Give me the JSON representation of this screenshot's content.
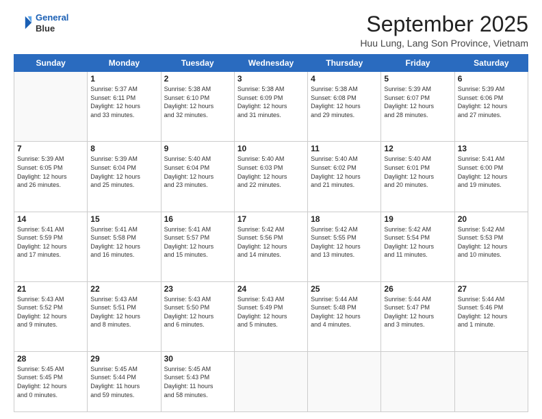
{
  "header": {
    "logo_line1": "General",
    "logo_line2": "Blue",
    "title": "September 2025",
    "subtitle": "Huu Lung, Lang Son Province, Vietnam"
  },
  "weekdays": [
    "Sunday",
    "Monday",
    "Tuesday",
    "Wednesday",
    "Thursday",
    "Friday",
    "Saturday"
  ],
  "weeks": [
    [
      {
        "day": "",
        "info": ""
      },
      {
        "day": "1",
        "info": "Sunrise: 5:37 AM\nSunset: 6:11 PM\nDaylight: 12 hours\nand 33 minutes."
      },
      {
        "day": "2",
        "info": "Sunrise: 5:38 AM\nSunset: 6:10 PM\nDaylight: 12 hours\nand 32 minutes."
      },
      {
        "day": "3",
        "info": "Sunrise: 5:38 AM\nSunset: 6:09 PM\nDaylight: 12 hours\nand 31 minutes."
      },
      {
        "day": "4",
        "info": "Sunrise: 5:38 AM\nSunset: 6:08 PM\nDaylight: 12 hours\nand 29 minutes."
      },
      {
        "day": "5",
        "info": "Sunrise: 5:39 AM\nSunset: 6:07 PM\nDaylight: 12 hours\nand 28 minutes."
      },
      {
        "day": "6",
        "info": "Sunrise: 5:39 AM\nSunset: 6:06 PM\nDaylight: 12 hours\nand 27 minutes."
      }
    ],
    [
      {
        "day": "7",
        "info": "Sunrise: 5:39 AM\nSunset: 6:05 PM\nDaylight: 12 hours\nand 26 minutes."
      },
      {
        "day": "8",
        "info": "Sunrise: 5:39 AM\nSunset: 6:04 PM\nDaylight: 12 hours\nand 25 minutes."
      },
      {
        "day": "9",
        "info": "Sunrise: 5:40 AM\nSunset: 6:04 PM\nDaylight: 12 hours\nand 23 minutes."
      },
      {
        "day": "10",
        "info": "Sunrise: 5:40 AM\nSunset: 6:03 PM\nDaylight: 12 hours\nand 22 minutes."
      },
      {
        "day": "11",
        "info": "Sunrise: 5:40 AM\nSunset: 6:02 PM\nDaylight: 12 hours\nand 21 minutes."
      },
      {
        "day": "12",
        "info": "Sunrise: 5:40 AM\nSunset: 6:01 PM\nDaylight: 12 hours\nand 20 minutes."
      },
      {
        "day": "13",
        "info": "Sunrise: 5:41 AM\nSunset: 6:00 PM\nDaylight: 12 hours\nand 19 minutes."
      }
    ],
    [
      {
        "day": "14",
        "info": "Sunrise: 5:41 AM\nSunset: 5:59 PM\nDaylight: 12 hours\nand 17 minutes."
      },
      {
        "day": "15",
        "info": "Sunrise: 5:41 AM\nSunset: 5:58 PM\nDaylight: 12 hours\nand 16 minutes."
      },
      {
        "day": "16",
        "info": "Sunrise: 5:41 AM\nSunset: 5:57 PM\nDaylight: 12 hours\nand 15 minutes."
      },
      {
        "day": "17",
        "info": "Sunrise: 5:42 AM\nSunset: 5:56 PM\nDaylight: 12 hours\nand 14 minutes."
      },
      {
        "day": "18",
        "info": "Sunrise: 5:42 AM\nSunset: 5:55 PM\nDaylight: 12 hours\nand 13 minutes."
      },
      {
        "day": "19",
        "info": "Sunrise: 5:42 AM\nSunset: 5:54 PM\nDaylight: 12 hours\nand 11 minutes."
      },
      {
        "day": "20",
        "info": "Sunrise: 5:42 AM\nSunset: 5:53 PM\nDaylight: 12 hours\nand 10 minutes."
      }
    ],
    [
      {
        "day": "21",
        "info": "Sunrise: 5:43 AM\nSunset: 5:52 PM\nDaylight: 12 hours\nand 9 minutes."
      },
      {
        "day": "22",
        "info": "Sunrise: 5:43 AM\nSunset: 5:51 PM\nDaylight: 12 hours\nand 8 minutes."
      },
      {
        "day": "23",
        "info": "Sunrise: 5:43 AM\nSunset: 5:50 PM\nDaylight: 12 hours\nand 6 minutes."
      },
      {
        "day": "24",
        "info": "Sunrise: 5:43 AM\nSunset: 5:49 PM\nDaylight: 12 hours\nand 5 minutes."
      },
      {
        "day": "25",
        "info": "Sunrise: 5:44 AM\nSunset: 5:48 PM\nDaylight: 12 hours\nand 4 minutes."
      },
      {
        "day": "26",
        "info": "Sunrise: 5:44 AM\nSunset: 5:47 PM\nDaylight: 12 hours\nand 3 minutes."
      },
      {
        "day": "27",
        "info": "Sunrise: 5:44 AM\nSunset: 5:46 PM\nDaylight: 12 hours\nand 1 minute."
      }
    ],
    [
      {
        "day": "28",
        "info": "Sunrise: 5:45 AM\nSunset: 5:45 PM\nDaylight: 12 hours\nand 0 minutes."
      },
      {
        "day": "29",
        "info": "Sunrise: 5:45 AM\nSunset: 5:44 PM\nDaylight: 11 hours\nand 59 minutes."
      },
      {
        "day": "30",
        "info": "Sunrise: 5:45 AM\nSunset: 5:43 PM\nDaylight: 11 hours\nand 58 minutes."
      },
      {
        "day": "",
        "info": ""
      },
      {
        "day": "",
        "info": ""
      },
      {
        "day": "",
        "info": ""
      },
      {
        "day": "",
        "info": ""
      }
    ]
  ]
}
